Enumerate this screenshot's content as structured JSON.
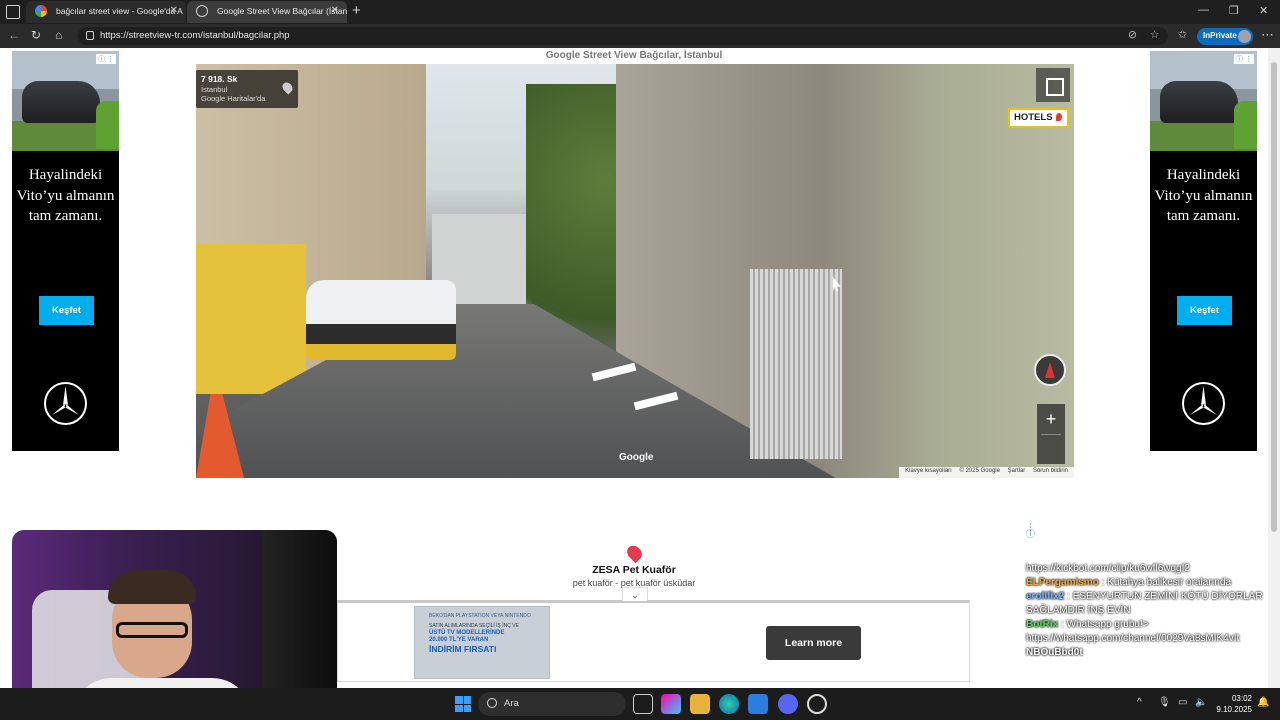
{
  "browser": {
    "tabs": [
      {
        "title": "bağcılar street view - Google'da A",
        "active": false
      },
      {
        "title": "Google Street View Bağcılar (İstan",
        "active": true
      }
    ],
    "url": "https://streetview-tr.com/istanbul/bagcilar.php",
    "inprivate_label": "InPrivate"
  },
  "page": {
    "title": "Google Street View Bağcılar, İstanbul",
    "side_ad": {
      "headline": "Hayalindeki Vito’yu almanın tam zamanı.",
      "cta": "Keşfet",
      "brand_icon": "mercedes-star-icon"
    },
    "streetview": {
      "street": "7 918. Sk",
      "city": "İstanbul",
      "maps_link": "Google Haritalar'da",
      "hotels_label": "HOTELS",
      "google_logo": "Google",
      "footer": [
        "Klavye kısayolları",
        "© 2025 Google",
        "Şartlar",
        "Sorun bildirin"
      ],
      "zoom_in": "+"
    },
    "place": {
      "name": "ZESA Pet Kuaför",
      "subtitle": "pet kuaför - pet kuaför üsküdar"
    },
    "banner_ad": {
      "promo_line1": "BEKO'DAN PLAYSTATION VEYA NINTENDO",
      "promo_line2": "SATIN ALIMLARINDA SEÇİLİ İŞ İNÇ VE",
      "promo_line3": "ÜSTÜ TV MODELLERİNDE",
      "promo_line4": "20.000 TL'YE VARAN",
      "promo_line5": "İNDİRİM FIRSATI",
      "cta": "Learn more"
    }
  },
  "chat": [
    {
      "user": "",
      "text": "https://kickbot.com/clip/ku6wfl6wqgf2"
    },
    {
      "user": "ELPergamismo",
      "text": "Kütahya balikesir oralarında"
    },
    {
      "user": "erolifix2",
      "text": "ESENYURTUN ZEMİNİ KÖTÜ DİYORLAR SAĞLAMDIR İNŞ EVİN"
    },
    {
      "user": "BotRix",
      "text": "Whatsapp grubu!>"
    },
    {
      "user": "",
      "text": "https://whatsapp.com/channel/0029Va8sMIK4vIt"
    },
    {
      "user": "",
      "text": "NBOuBbd0t"
    }
  ],
  "taskbar": {
    "search_label": "Ara",
    "time": "03:02",
    "date": "9.10.2025"
  },
  "colors": {
    "accent": "#0f6cbd",
    "kesfet": "#00adef",
    "hotels_border": "#e8c20e"
  }
}
